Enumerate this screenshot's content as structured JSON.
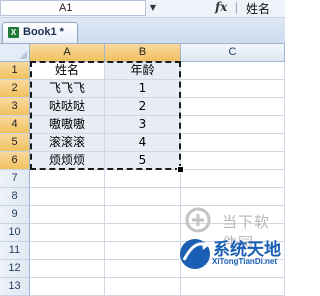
{
  "formula_bar": {
    "name_box": "A1",
    "fx_label": "fx",
    "formula": "姓名"
  },
  "workbook_tab": {
    "label": "Book1 *",
    "icon": "excel-icon"
  },
  "columns": [
    "A",
    "B",
    "C"
  ],
  "rows": [
    "1",
    "2",
    "3",
    "4",
    "5",
    "6",
    "7",
    "8",
    "9",
    "10",
    "11",
    "12",
    "13"
  ],
  "cells": [
    [
      "姓名",
      "年龄"
    ],
    [
      "飞飞飞",
      "1"
    ],
    [
      "哒哒哒",
      "2"
    ],
    [
      "嗷嗷嗷",
      "3"
    ],
    [
      "滚滚滚",
      "4"
    ],
    [
      "烦烦烦",
      "5"
    ]
  ],
  "watermarks": {
    "site1": "当下软件园",
    "site2_main": "系统天地",
    "site2_sub": "XiTongTianDi.net"
  },
  "colors": {
    "selection_header": "#f1c15f",
    "brand_blue": "#1a5fb4"
  }
}
